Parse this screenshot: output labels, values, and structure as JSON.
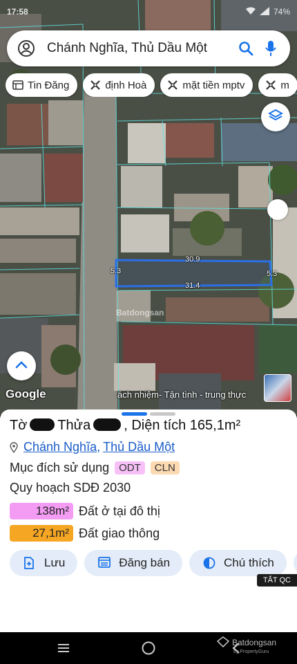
{
  "status": {
    "time": "17:58",
    "battery": "74%"
  },
  "search": {
    "text": "Chánh Nghĩa, Thủ Dầu Một"
  },
  "chips": [
    {
      "label": "Tin Đăng",
      "icon": "list-icon"
    },
    {
      "label": "định Hoà",
      "icon": "tag-cross-icon"
    },
    {
      "label": "mặt tiền mptv",
      "icon": "tag-cross-icon"
    },
    {
      "label": "m",
      "icon": "tag-cross-icon"
    }
  ],
  "map": {
    "google_label": "Google",
    "slogan": "ách nhiệm- Tận tình - trung thực",
    "watermark": "Batdongsan",
    "dimensions": {
      "top": "30.9",
      "bottom": "31.4",
      "left": "5.3",
      "right": "5.3"
    }
  },
  "parcel": {
    "to_label": "Tờ",
    "thua_label": "Thửa",
    "area_text": ", Diện tích 165,1m²",
    "ward": "Chánh Nghĩa",
    "comma": ",",
    "city": "Thủ Dầu Một",
    "purpose_label": "Mục đích sử dụng",
    "purpose_tags": [
      "ODT",
      "CLN"
    ],
    "plan_title": "Quy hoạch SDĐ 2030",
    "zones": [
      {
        "value": "138m²",
        "label": "Đất ở tại đô thị",
        "color": "#f49cf4"
      },
      {
        "value": "27,1m²",
        "label": "Đất giao thông",
        "color": "#f5a623"
      }
    ]
  },
  "actions": [
    {
      "label": "Lưu",
      "icon": "bookmark-add-icon"
    },
    {
      "label": "Đăng bán",
      "icon": "listing-icon"
    },
    {
      "label": "Chú thích",
      "icon": "legend-icon"
    }
  ],
  "ad_badge": "TẮT QC",
  "brand": {
    "name": "Batdongsan",
    "sub": "by PropertyGuru"
  },
  "colors": {
    "accent": "#1a73e8",
    "parcel_outline": "#2b6fe8",
    "button_bg": "#e3ecf8"
  }
}
